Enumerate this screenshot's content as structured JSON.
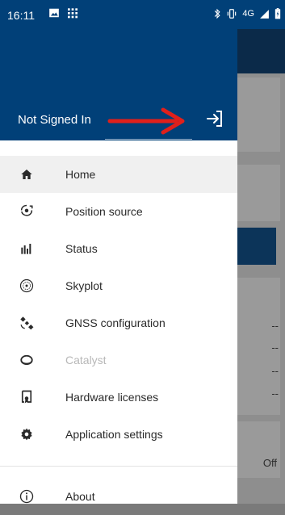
{
  "status_bar": {
    "time": "16:11",
    "network": "4G"
  },
  "header": {
    "signin_status": "Not Signed In"
  },
  "menu": [
    {
      "label": "Home",
      "icon": "home-icon",
      "selected": true
    },
    {
      "label": "Position source",
      "icon": "position-source-icon"
    },
    {
      "label": "Status",
      "icon": "status-bars-icon"
    },
    {
      "label": "Skyplot",
      "icon": "skyplot-icon"
    },
    {
      "label": "GNSS configuration",
      "icon": "satellite-icon"
    },
    {
      "label": "Catalyst",
      "icon": "catalyst-icon",
      "disabled": true
    },
    {
      "label": "Hardware licenses",
      "icon": "license-icon"
    },
    {
      "label": "Application settings",
      "icon": "gear-icon"
    }
  ],
  "footer_menu": [
    {
      "label": "About",
      "icon": "info-icon"
    }
  ],
  "background": {
    "dashes": [
      "--",
      "--",
      "--",
      "--"
    ],
    "off_label": "Off"
  },
  "colors": {
    "header": "#014078",
    "annotation_arrow": "#e0201b"
  }
}
